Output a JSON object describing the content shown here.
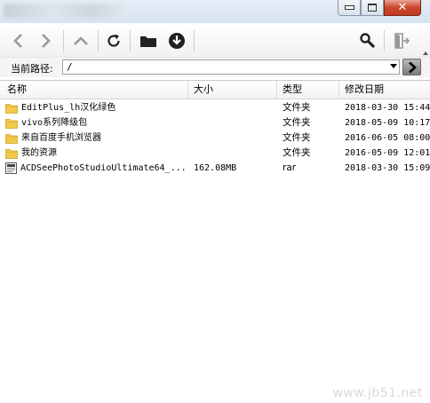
{
  "toolbar": {
    "icons": [
      "back-icon",
      "forward-icon",
      "up-icon",
      "refresh-icon",
      "folder-icon",
      "download-icon",
      "search-icon",
      "exit-icon"
    ]
  },
  "pathbar": {
    "label": "当前路径:",
    "value": "/"
  },
  "columns": {
    "name": "名称",
    "size": "大小",
    "type": "类型",
    "date": "修改日期"
  },
  "rows": [
    {
      "name": "EditPlus_lh汉化绿色",
      "size": "",
      "type": "文件夹",
      "date": "2018-03-30 15:44",
      "icon": "folder-icon"
    },
    {
      "name": "vivo系列降级包",
      "size": "",
      "type": "文件夹",
      "date": "2018-05-09 10:17",
      "icon": "folder-icon"
    },
    {
      "name": "来自百度手机浏览器",
      "size": "",
      "type": "文件夹",
      "date": "2016-06-05 08:00",
      "icon": "folder-icon"
    },
    {
      "name": "我的资源",
      "size": "",
      "type": "文件夹",
      "date": "2016-05-09 12:01",
      "icon": "folder-icon"
    },
    {
      "name": "ACDSeePhotoStudioUltimate64_...",
      "size": "162.08MB",
      "type": "rar",
      "date": "2018-03-30 15:09",
      "icon": "file-icon"
    }
  ],
  "watermark": "www.jb51.net",
  "colors": {
    "folder": "#f2c94c",
    "close_button": "#c9462c",
    "go_button": "#7a7a7a"
  }
}
